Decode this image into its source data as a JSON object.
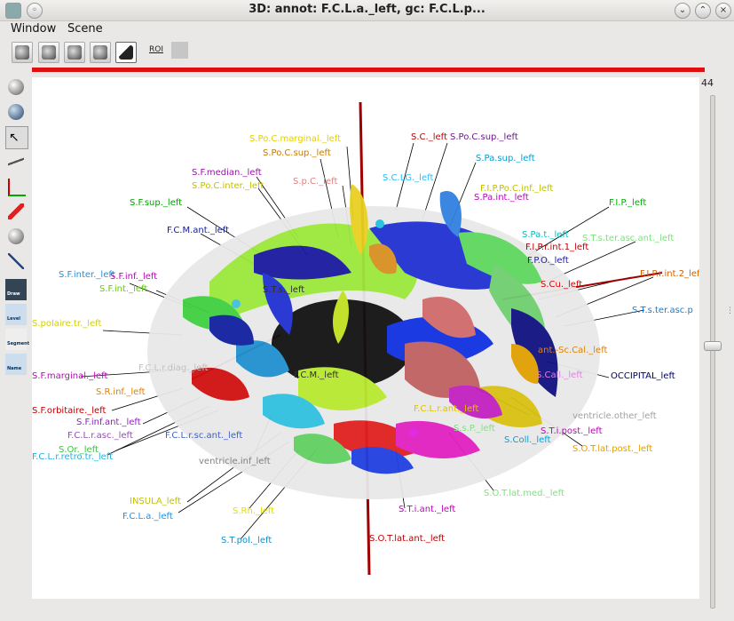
{
  "window": {
    "title": "3D: annot: F.C.L.a._left, gc: F.C.L.p..."
  },
  "menu": [
    "Window",
    "Scene"
  ],
  "toolbar": {
    "roi_label": "ROI"
  },
  "left_tools": [
    "sphere",
    "sphere-view",
    "select",
    "plane",
    "axis",
    "pencil",
    "sphere-2",
    "cross",
    "Draw",
    "Level",
    "Segment",
    "Name"
  ],
  "slice": {
    "value": "44"
  },
  "labels": [
    {
      "t": "S.Po.C.marginal._left",
      "c": "#e6d000"
    },
    {
      "t": "S.C._left",
      "c": "#c00000"
    },
    {
      "t": "S.Po.C.sup._left",
      "c": "#6a1a8a"
    },
    {
      "t": "S.Po.C.sup._left",
      "c": "#c87800"
    },
    {
      "t": "S.Pa.sup._left",
      "c": "#00a0d0"
    },
    {
      "t": "S.F.median._left",
      "c": "#9a10b0"
    },
    {
      "t": "S.Po.C.inter._left",
      "c": "#c0c000"
    },
    {
      "t": "S.p.C._left",
      "c": "#e08080"
    },
    {
      "t": "S.C.LG._left",
      "c": "#20c0ff"
    },
    {
      "t": "F.I.P.Po.C.inf._left",
      "c": "#c0c000"
    },
    {
      "t": "S.Pa.int._left",
      "c": "#c000c0"
    },
    {
      "t": "S.F.sup._left",
      "c": "#00a000"
    },
    {
      "t": "F.I.P._left",
      "c": "#00b000"
    },
    {
      "t": "F.C.M.ant._left",
      "c": "#1020a0"
    },
    {
      "t": "S.Pa.t._left",
      "c": "#00c0c0"
    },
    {
      "t": "S.T.s.ter.asc.ant._left",
      "c": "#80e080"
    },
    {
      "t": "F.I.P.r.int.1_left",
      "c": "#c00000"
    },
    {
      "t": "F.P.O._left",
      "c": "#2020a0"
    },
    {
      "t": "F.I.P.r.int.2_left",
      "c": "#d06000"
    },
    {
      "t": "S.F.inter._left",
      "c": "#2090e0"
    },
    {
      "t": "S.F.inf._left",
      "c": "#c000c0"
    },
    {
      "t": "S.F.int._left",
      "c": "#60d000"
    },
    {
      "t": "S.Cu._left",
      "c": "#e00000"
    },
    {
      "t": "S.T.s.ter.asc.p",
      "c": "#1080e0"
    },
    {
      "t": "S.polaire.tr._left",
      "c": "#d0d000"
    },
    {
      "t": "ant.-Sc.Cal._left",
      "c": "#e08000"
    },
    {
      "t": "S.F.marginal._left",
      "c": "#c000c0"
    },
    {
      "t": "F.C.L.r.diag._left",
      "c": "#c0c0c0"
    },
    {
      "t": "S.Call._left",
      "c": "#e080e0"
    },
    {
      "t": "OCCIPITAL_left",
      "c": "#000060"
    },
    {
      "t": "S.R.inf._left",
      "c": "#e08000"
    },
    {
      "t": "S.F.orbitaire._left",
      "c": "#c00000"
    },
    {
      "t": "ventricle.other_left",
      "c": "#a0a0a0"
    },
    {
      "t": "S.F.inf.ant._left",
      "c": "#9020c0"
    },
    {
      "t": "S.T.i.post._left",
      "c": "#c000c0"
    },
    {
      "t": "F.C.L.r.asc._left",
      "c": "#9050b0"
    },
    {
      "t": "F.C.L.r.sc.ant._left",
      "c": "#4060c0"
    },
    {
      "t": "S.Coll._left",
      "c": "#00a0e0"
    },
    {
      "t": "S.O.T.lat.post._left",
      "c": "#e0a000"
    },
    {
      "t": "S.Or._left",
      "c": "#40c040"
    },
    {
      "t": "F.C.L.r.retro.tr._left",
      "c": "#20b0e0"
    },
    {
      "t": "ventricle.inf_left",
      "c": "#808080"
    },
    {
      "t": "S.O.T.lat.med._left",
      "c": "#80e080"
    },
    {
      "t": "INSULA_left",
      "c": "#c0c000"
    },
    {
      "t": "S.Rh._left",
      "c": "#e0e000"
    },
    {
      "t": "S.T.i.ant._left",
      "c": "#c000c0"
    },
    {
      "t": "F.C.L.a._left",
      "c": "#2090e0"
    },
    {
      "t": "S.T.pol._left",
      "c": "#1090d0"
    },
    {
      "t": "S.O.T.lat.ant._left",
      "c": "#c00000"
    },
    {
      "t": "F.C.L.r.ant._left",
      "c": "#e0c000"
    },
    {
      "t": "S.s.P._left",
      "c": "#80e080"
    },
    {
      "t": "F.C.M._left",
      "c": "#303030"
    },
    {
      "t": "S.T.s._left",
      "c": "#303030"
    }
  ]
}
